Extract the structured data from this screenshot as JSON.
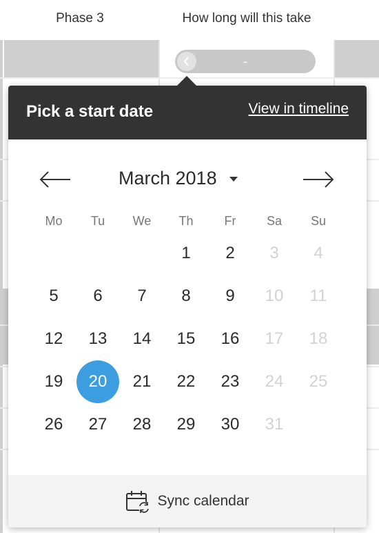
{
  "columns": {
    "phase": "Phase 3",
    "duration": "How long will this take"
  },
  "duration_pill": {
    "value": "-",
    "icon": "chevron-left-icon"
  },
  "popover": {
    "title": "Pick a start date",
    "link": "View in timeline",
    "month_label": "March 2018",
    "prev_icon": "arrow-left-icon",
    "next_icon": "arrow-right-icon",
    "weekdays": [
      "Mo",
      "Tu",
      "We",
      "Th",
      "Fr",
      "Sa",
      "Su"
    ],
    "weeks": [
      [
        "",
        "",
        "",
        "1",
        "2",
        "3",
        "4"
      ],
      [
        "5",
        "6",
        "7",
        "8",
        "9",
        "10",
        "11"
      ],
      [
        "12",
        "13",
        "14",
        "15",
        "16",
        "17",
        "18"
      ],
      [
        "19",
        "20",
        "21",
        "22",
        "23",
        "24",
        "25"
      ],
      [
        "26",
        "27",
        "28",
        "29",
        "30",
        "31",
        ""
      ]
    ],
    "selected_day": "20",
    "footer_label": "Sync calendar",
    "footer_icon": "calendar-sync-icon"
  },
  "colors": {
    "header_bg": "#333333",
    "selected": "#3c9ee0",
    "weekend_text": "#d2d2d2"
  }
}
